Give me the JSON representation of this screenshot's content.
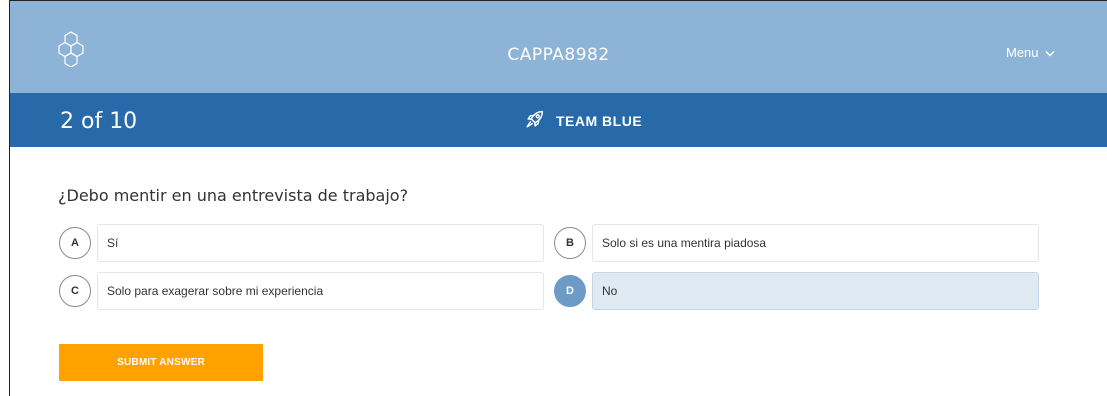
{
  "header": {
    "app_code": "CAPPA8982",
    "menu_label": "Menu",
    "logo_icon": "hexagon-logo-icon",
    "background": "#8db3d6"
  },
  "subheader": {
    "progress": "2 of 10",
    "team_label": "TEAM BLUE",
    "team_icon": "rocket-icon",
    "background": "#286aa9"
  },
  "question": {
    "text": "¿Debo mentir en una entrevista de trabajo?"
  },
  "options": [
    {
      "letter": "A",
      "text": "Sí",
      "selected": false
    },
    {
      "letter": "B",
      "text": "Solo si es una mentira piadosa",
      "selected": false
    },
    {
      "letter": "C",
      "text": "Solo para exagerar sobre mi experiencia",
      "selected": false
    },
    {
      "letter": "D",
      "text": "No",
      "selected": true
    }
  ],
  "submit": {
    "label": "SUBMIT ANSWER",
    "color": "#ffa200"
  }
}
